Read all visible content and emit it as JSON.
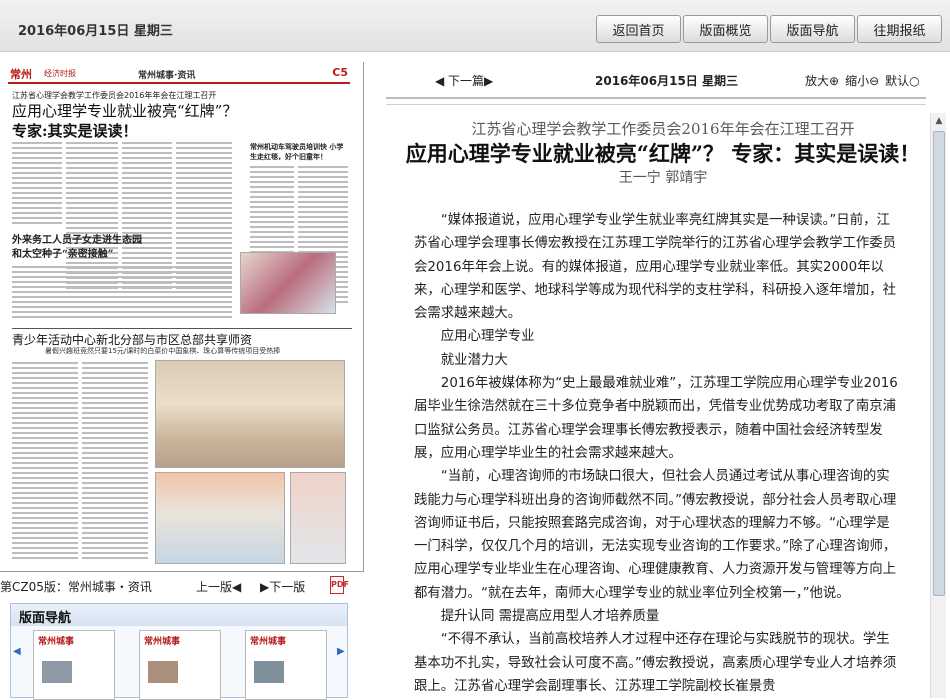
{
  "header": {
    "date": "2016年06月15日  星期三",
    "nav": [
      "返回首页",
      "版面概览",
      "版面导航",
      "往期报纸"
    ]
  },
  "paper": {
    "masthead_logo": "常州",
    "masthead_subtitle": "经济时报",
    "section": "常州城事·资讯",
    "page_no": "C5",
    "kicker": "江苏省心理学会教学工作委员会2016年年会在江理工召开",
    "title1": "应用心理学专业就业被亮“红牌”？",
    "title2": "专家:其实是误读！",
    "sub1": "外来务工人员子女走进生态园\n和太空种子“亲密接触”",
    "sub2": "常州机动车驾驶员培训快\n小学生走红毯，好个旧童年！",
    "head2": "青少年活动中心新北分部与市区总部共享师资",
    "head2sub": "暑假兴趣班竞然只要15元/课时的白菜价中国象棋、珠心算等传统项目受热捧"
  },
  "pager": {
    "label": "第CZ05版：常州城事・资讯",
    "prev": "上一版◀",
    "next": "▶下一版",
    "pdf": "PDF"
  },
  "thumbs": {
    "title": "版面导航",
    "items": [
      "常州城事",
      "常州城事",
      "常州城事"
    ]
  },
  "article_nav": {
    "prev": "◀ 下一篇▶",
    "date": "2016年06月15日  星期三",
    "zoom_in": "放大⊕",
    "zoom_out": "缩小⊖",
    "default": "默认○"
  },
  "article": {
    "kicker": "江苏省心理学会教学工作委员会2016年年会在江理工召开",
    "title": "应用心理学专业就业被亮“红牌”？ 专家：其实是误读！",
    "author": "王一宁  郭靖宇",
    "paragraphs": [
      "“媒体报道说，应用心理学专业学生就业率亮红牌其实是一种误读。”日前，江苏省心理学会理事长傅宏教授在江苏理工学院举行的江苏省心理学会教学工作委员会2016年年会上说。有的媒体报道，应用心理学专业就业率低。其实2000年以来，心理学和医学、地球科学等成为现代科学的支柱学科，科研投入逐年增加，社会需求越来越大。",
      "应用心理学专业",
      "就业潜力大",
      "2016年被媒体称为“史上最最难就业难”，江苏理工学院应用心理学专业2016届毕业生徐浩然就在三十多位竞争者中脱颖而出，凭借专业优势成功考取了南京浦口监狱公务员。江苏省心理学会理事长傅宏教授表示，随着中国社会经济转型发展，应用心理学毕业生的社会需求越来越大。",
      "“当前，心理咨询师的市场缺口很大，但社会人员通过考试从事心理咨询的实践能力与心理学科班出身的咨询师截然不同。”傅宏教授说，部分社会人员考取心理咨询师证书后，只能按照套路完成咨询，对于心理状态的理解力不够。“心理学是一门科学，仅仅几个月的培训，无法实现专业咨询的工作要求。”除了心理咨询师，应用心理学专业毕业生在心理咨询、心理健康教育、人力资源开发与管理等方向上都有潜力。“就在去年，南师大心理学专业的就业率位列全校第一，”他说。",
      "提升认同  需提高应用型人才培养质量",
      "“不得不承认，当前高校培养人才过程中还存在理论与实践脱节的现状。学生基本功不扎实，导致社会认可度不高。”傅宏教授说，高素质心理学专业人才培养须跟上。江苏省心理学会副理事长、江苏理工学院副校长崔景贵"
    ]
  }
}
